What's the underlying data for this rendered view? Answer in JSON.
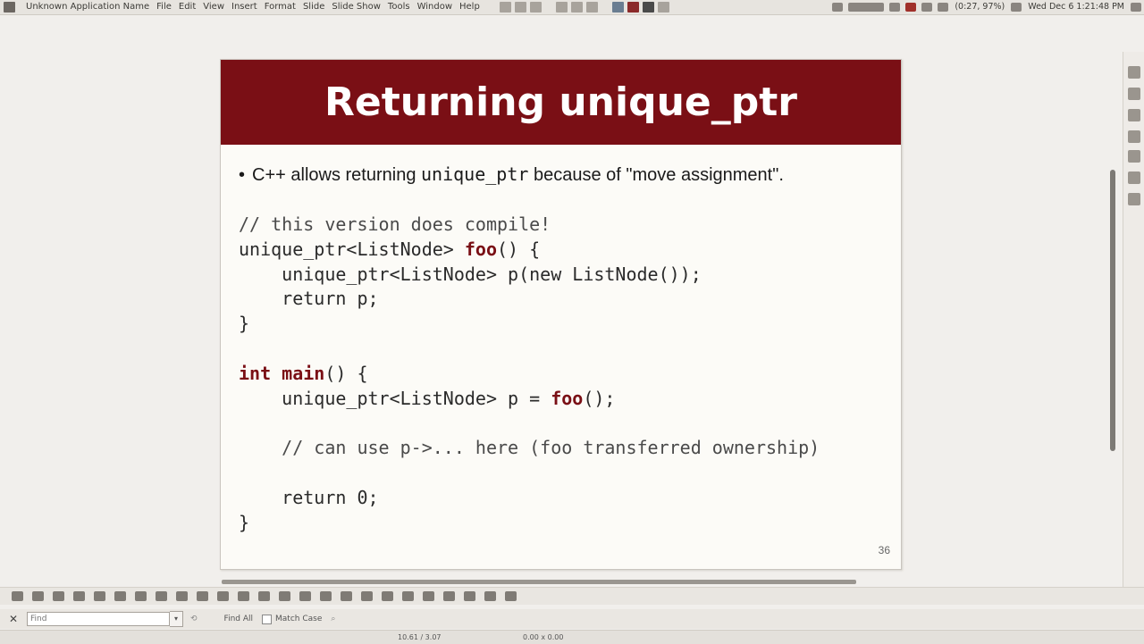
{
  "menubar": {
    "app_name": "Unknown Application Name",
    "items": [
      "File",
      "Edit",
      "View",
      "Insert",
      "Format",
      "Slide",
      "Slide Show",
      "Tools",
      "Window",
      "Help"
    ],
    "tray": {
      "battery": "(0:27, 97%)",
      "datetime": "Wed Dec 6   1:21:48 PM"
    }
  },
  "slide": {
    "title": "Returning unique_ptr",
    "bullet": {
      "before": "C++ allows returning ",
      "code": "unique_ptr",
      "after": " because of \"move assignment\"."
    },
    "code_lines": [
      "// this version does compile!",
      "unique_ptr<ListNode> foo() {",
      "    unique_ptr<ListNode> p(new ListNode());",
      "    return p;",
      "}",
      "",
      "int main() {",
      "    unique_ptr<ListNode> p = foo();",
      "",
      "    // can use p->... here (foo transferred ownership)",
      "",
      "    return 0;",
      "}"
    ],
    "page_number": "36",
    "colors": {
      "title_bar": "#7a0f15",
      "keyword": "#7a0f15"
    }
  },
  "findbar": {
    "placeholder": "Find",
    "find_all": "Find All",
    "match_case": "Match Case"
  },
  "statusbar": {
    "position": "10.61 / 3.07",
    "size": "0.00 x 0.00"
  }
}
